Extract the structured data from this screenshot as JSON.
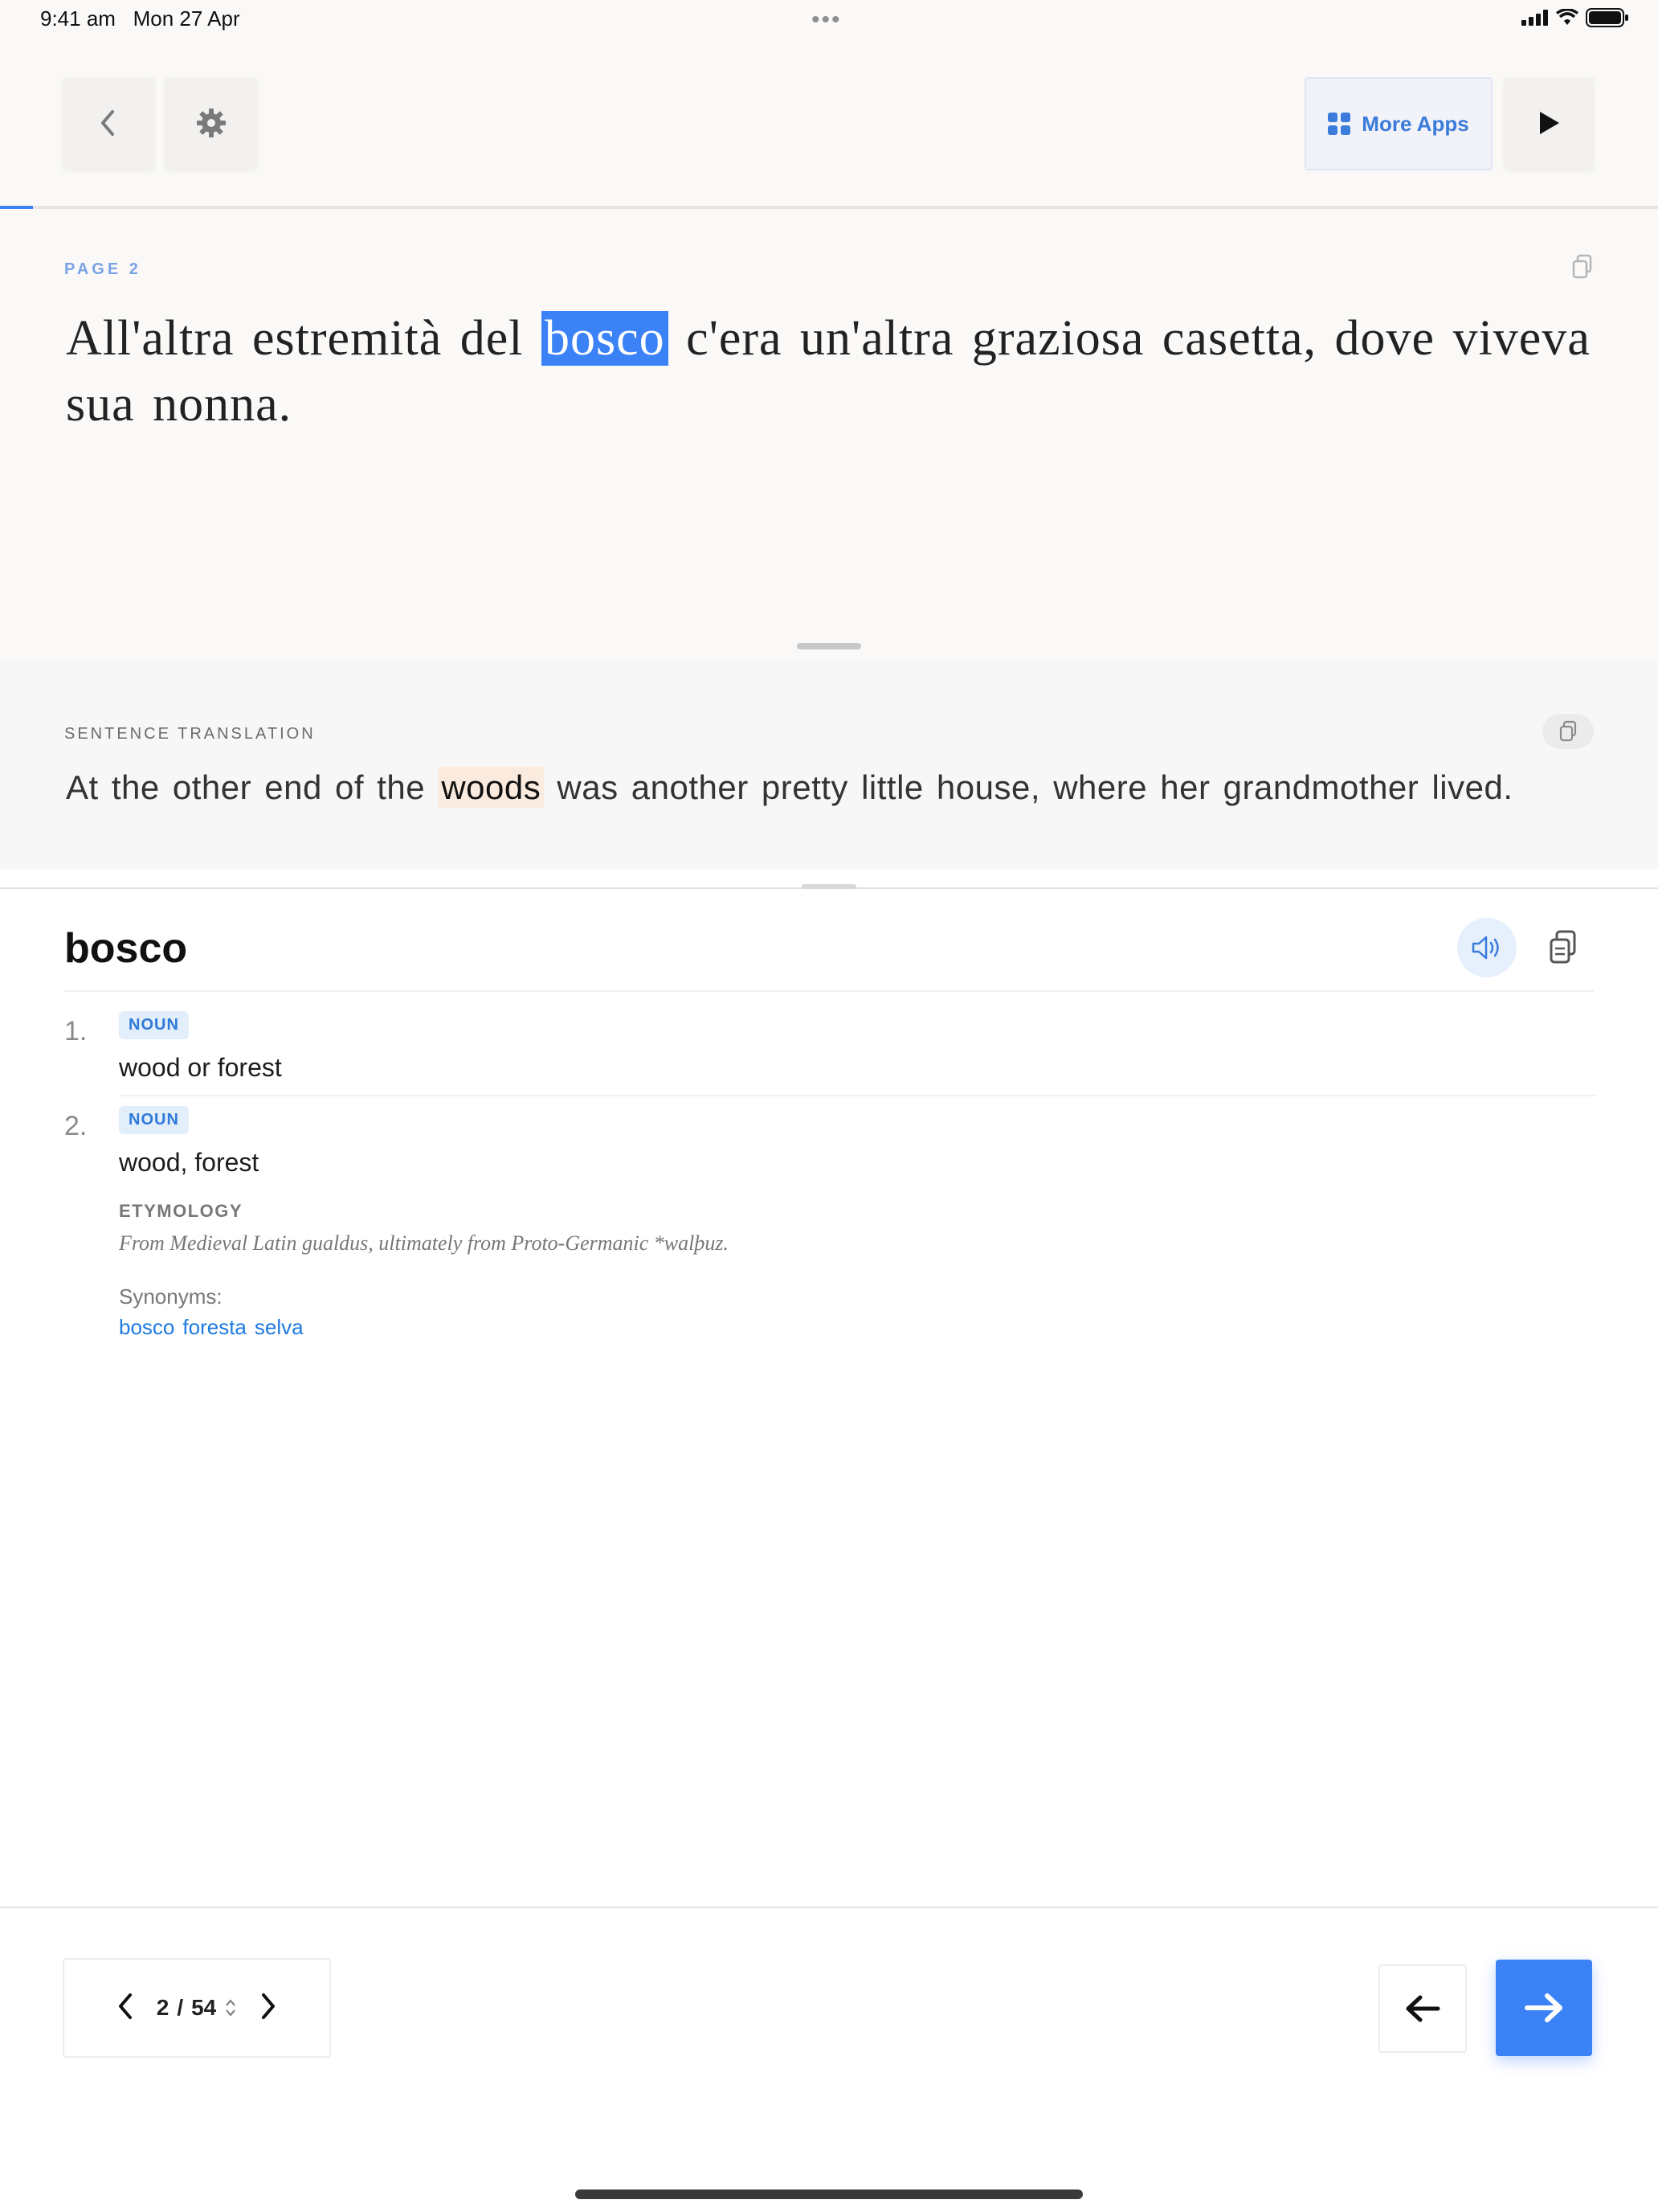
{
  "status_bar": {
    "time": "9:41 am",
    "date": "Mon 27 Apr",
    "dots": "•••"
  },
  "header": {
    "more_apps_label": "More Apps",
    "reading_progress": 0.02
  },
  "reader": {
    "page_label": "PAGE  2",
    "sentence_before": "All'altra estremità del ",
    "highlighted_word": "bosco",
    "sentence_after": " c'era un'altra graziosa casetta, dove viveva sua nonna."
  },
  "translation": {
    "label": "SENTENCE TRANSLATION",
    "before": "At the other end of the ",
    "highlighted_word": "woods",
    "after": " was another pretty little house, where her grandmother lived."
  },
  "dictionary": {
    "word": "bosco",
    "definitions": [
      {
        "num": "1.",
        "pos": "NOUN",
        "text": "wood or forest"
      },
      {
        "num": "2.",
        "pos": "NOUN",
        "text": "wood, forest"
      }
    ],
    "etymology_label": "ETYMOLOGY",
    "etymology_text": "From Medieval Latin gualdus, ultimately from Proto-Germanic *walþuz.",
    "synonyms_label": "Synonyms:",
    "synonyms": [
      "bosco",
      "foresta",
      "selva"
    ]
  },
  "pager": {
    "current": "2",
    "separator": "/",
    "total": "54"
  },
  "colors": {
    "accent": "#3b82f6",
    "translation_highlight": "#fbebde",
    "badge_bg": "#e3eefb"
  },
  "icons": [
    "chevron-left-icon",
    "gear-icon",
    "grid-icon",
    "play-icon",
    "copy-icon",
    "speaker-icon",
    "arrow-left-icon",
    "arrow-right-icon",
    "sort-icon",
    "signal-icon",
    "wifi-icon",
    "battery-icon"
  ]
}
